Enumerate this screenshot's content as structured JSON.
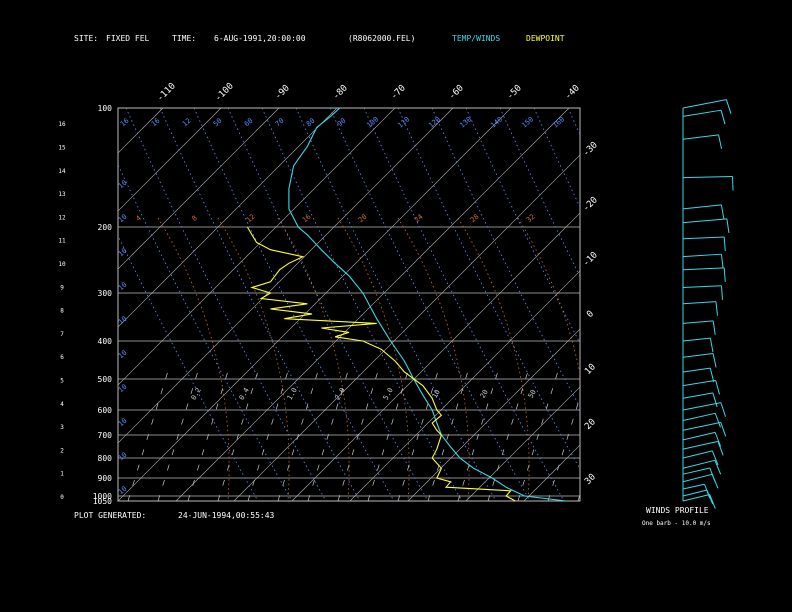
{
  "header": {
    "site_label": "SITE:",
    "site_value": "FIXED FEL",
    "time_label": "TIME:",
    "time_value": "6-AUG-1991,20:00:00",
    "file": "(R8062000.FEL)",
    "temp_winds": "TEMP/WINDS",
    "dewpoint": "DEWPOINT"
  },
  "footer": {
    "generated_label": "PLOT GENERATED:",
    "generated_value": "24-JUN-1994,00:55:43"
  },
  "winds_panel": {
    "title": "WINDS PROFILE",
    "note": "One barb - 10.0 m/s"
  },
  "colors": {
    "temp": "#36d9e8",
    "dewpoint": "#ffff33",
    "grid": "#bbbbbb",
    "mixing": "#5a8cff",
    "adiabat": "#d2693c"
  },
  "chart_data": {
    "type": "line",
    "pressure_levels": [
      "100",
      "200",
      "300",
      "400",
      "500",
      "600",
      "700",
      "800",
      "900",
      "1000",
      "1050"
    ],
    "height_km": [
      "0",
      "1",
      "2",
      "3",
      "4",
      "5",
      "6",
      "7",
      "8",
      "9",
      "10",
      "11",
      "12",
      "13",
      "14",
      "15",
      "16"
    ],
    "isotherm_labels": [
      "-110",
      "-100",
      "-90",
      "-80",
      "-70",
      "-60",
      "-50",
      "-40",
      "-30",
      "-20",
      "-10",
      "0",
      "10",
      "20",
      "30"
    ],
    "upper_numbers": [
      "16",
      "16",
      "12",
      "50",
      "60",
      "70",
      "80",
      "90",
      "100",
      "110",
      "120",
      "130",
      "140",
      "150",
      "160"
    ],
    "mid_numbers": [
      "4",
      "8",
      "12",
      "16",
      "20",
      "24",
      "28",
      "32"
    ],
    "lower_numbers": [
      "0.2",
      "0.4",
      "1.0",
      "2.0",
      "5.0",
      "10",
      "20",
      "50"
    ],
    "left_numbers": [
      "10",
      "10",
      "10",
      "10",
      "10",
      "10",
      "10",
      "10",
      "10",
      "10"
    ],
    "series": [
      {
        "name": "TEMP/WINDS",
        "color": "#36d9e8",
        "points": [
          [
            1050,
            0.97
          ],
          [
            1000,
            0.88
          ],
          [
            950,
            0.84
          ],
          [
            900,
            0.81
          ],
          [
            850,
            0.77
          ],
          [
            800,
            0.74
          ],
          [
            750,
            0.72
          ],
          [
            700,
            0.7
          ],
          [
            650,
            0.69
          ],
          [
            600,
            0.68
          ],
          [
            550,
            0.66
          ],
          [
            500,
            0.64
          ],
          [
            450,
            0.62
          ],
          [
            400,
            0.59
          ],
          [
            350,
            0.56
          ],
          [
            300,
            0.53
          ],
          [
            270,
            0.5
          ],
          [
            250,
            0.47
          ],
          [
            230,
            0.44
          ],
          [
            210,
            0.41
          ],
          [
            200,
            0.39
          ],
          [
            180,
            0.37
          ],
          [
            160,
            0.37
          ],
          [
            140,
            0.38
          ],
          [
            125,
            0.41
          ],
          [
            112,
            0.43
          ],
          [
            105,
            0.46
          ],
          [
            100,
            0.48
          ]
        ]
      },
      {
        "name": "DEWPOINT",
        "color": "#ffff33",
        "points": [
          [
            1050,
            0.86
          ],
          [
            1000,
            0.84
          ],
          [
            970,
            0.85
          ],
          [
            950,
            0.71
          ],
          [
            920,
            0.72
          ],
          [
            900,
            0.69
          ],
          [
            850,
            0.7
          ],
          [
            800,
            0.68
          ],
          [
            760,
            0.69
          ],
          [
            700,
            0.7
          ],
          [
            680,
            0.69
          ],
          [
            650,
            0.68
          ],
          [
            620,
            0.7
          ],
          [
            600,
            0.69
          ],
          [
            560,
            0.68
          ],
          [
            520,
            0.66
          ],
          [
            480,
            0.62
          ],
          [
            450,
            0.6
          ],
          [
            420,
            0.57
          ],
          [
            400,
            0.53
          ],
          [
            390,
            0.47
          ],
          [
            380,
            0.5
          ],
          [
            370,
            0.44
          ],
          [
            360,
            0.56
          ],
          [
            350,
            0.36
          ],
          [
            340,
            0.42
          ],
          [
            330,
            0.33
          ],
          [
            320,
            0.41
          ],
          [
            310,
            0.31
          ],
          [
            300,
            0.33
          ],
          [
            290,
            0.29
          ],
          [
            280,
            0.33
          ],
          [
            260,
            0.35
          ],
          [
            250,
            0.37
          ],
          [
            240,
            0.4
          ],
          [
            230,
            0.33
          ],
          [
            220,
            0.3
          ],
          [
            210,
            0.29
          ],
          [
            200,
            0.28
          ]
        ]
      }
    ],
    "winds": [
      {
        "p": 1050,
        "len": 0.5,
        "ang": -70
      },
      {
        "p": 1000,
        "len": 0.45,
        "ang": -75
      },
      {
        "p": 960,
        "len": 0.4,
        "ang": -60
      },
      {
        "p": 920,
        "len": 0.55,
        "ang": -80
      },
      {
        "p": 880,
        "len": 0.5,
        "ang": -65
      },
      {
        "p": 850,
        "len": 0.6,
        "ang": -75
      },
      {
        "p": 800,
        "len": 0.55,
        "ang": -70
      },
      {
        "p": 760,
        "len": 0.65,
        "ang": -60
      },
      {
        "p": 720,
        "len": 0.6,
        "ang": -65
      },
      {
        "p": 680,
        "len": 0.7,
        "ang": -55
      },
      {
        "p": 640,
        "len": 0.6,
        "ang": -60
      },
      {
        "p": 600,
        "len": 0.7,
        "ang": -50
      },
      {
        "p": 560,
        "len": 0.55,
        "ang": -45
      },
      {
        "p": 520,
        "len": 0.6,
        "ang": -40
      },
      {
        "p": 480,
        "len": 0.5,
        "ang": -35
      },
      {
        "p": 440,
        "len": 0.55,
        "ang": -30
      },
      {
        "p": 400,
        "len": 0.5,
        "ang": -25
      },
      {
        "p": 360,
        "len": 0.55,
        "ang": -20
      },
      {
        "p": 320,
        "len": 0.6,
        "ang": -15
      },
      {
        "p": 290,
        "len": 0.7,
        "ang": -10
      },
      {
        "p": 260,
        "len": 0.75,
        "ang": -10
      },
      {
        "p": 240,
        "len": 0.7,
        "ang": -15
      },
      {
        "p": 215,
        "len": 0.75,
        "ang": -10
      },
      {
        "p": 195,
        "len": 0.8,
        "ang": -20
      },
      {
        "p": 180,
        "len": 0.7,
        "ang": -25
      },
      {
        "p": 150,
        "len": 0.9,
        "ang": -5
      },
      {
        "p": 120,
        "len": 0.65,
        "ang": -30
      },
      {
        "p": 105,
        "len": 0.7,
        "ang": -40
      },
      {
        "p": 100,
        "len": 0.8,
        "ang": -50
      }
    ]
  }
}
